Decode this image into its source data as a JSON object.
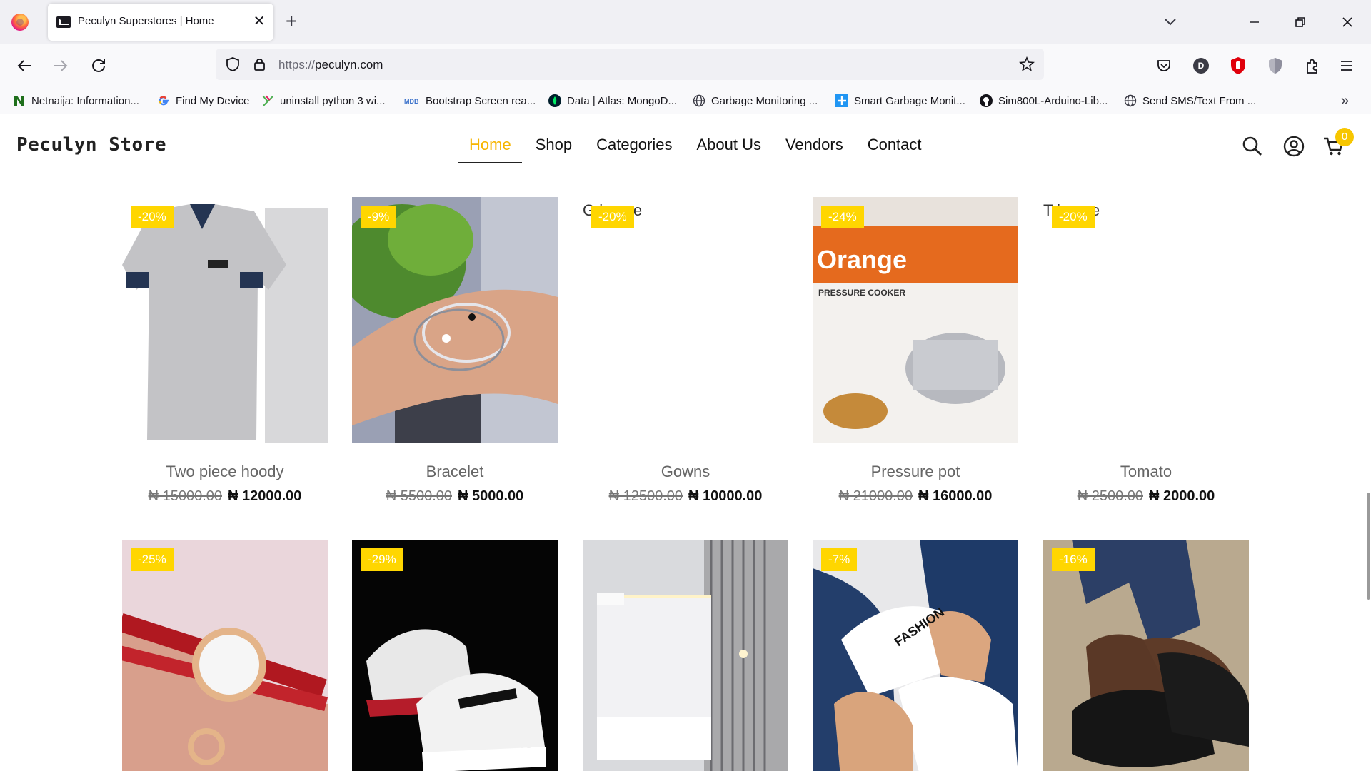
{
  "browser": {
    "tab_title": "Peculyn Superstores | Home",
    "url_scheme": "https://",
    "url_host": "peculyn.com",
    "profile_initial": "D",
    "bookmarks": [
      {
        "label": "Netnaija: Information...",
        "icon": "netnaija-icon"
      },
      {
        "label": "Find My Device",
        "icon": "google-icon"
      },
      {
        "label": "uninstall python 3 wi...",
        "icon": "bookmark-site-icon"
      },
      {
        "label": "Bootstrap Screen rea...",
        "icon": "mdb-icon"
      },
      {
        "label": "Data | Atlas: MongoD...",
        "icon": "mongodb-icon"
      },
      {
        "label": "Garbage Monitoring ...",
        "icon": "globe-icon"
      },
      {
        "label": "Smart Garbage Monit...",
        "icon": "bookmark-site-icon"
      },
      {
        "label": "Sim800L-Arduino-Lib...",
        "icon": "github-icon"
      },
      {
        "label": "Send SMS/Text From ...",
        "icon": "globe-icon"
      }
    ]
  },
  "site": {
    "brand": "Peculyn Store",
    "nav": [
      "Home",
      "Shop",
      "Categories",
      "About Us",
      "Vendors",
      "Contact"
    ],
    "active_nav": "Home",
    "cart_count": "0",
    "accent_color": "#f7b500",
    "badge_color": "#ffd600"
  },
  "products": [
    {
      "name": "Two piece hoody",
      "discount": "-20%",
      "old_price": "₦ 15000.00",
      "new_price": "₦ 12000.00",
      "alt": ""
    },
    {
      "name": "Bracelet",
      "discount": "-9%",
      "old_price": "₦ 5500.00",
      "new_price": "₦ 5000.00",
      "alt": ""
    },
    {
      "name": "Gowns",
      "discount": "-20%",
      "old_price": "₦ 12500.00",
      "new_price": "₦ 10000.00",
      "alt": "G      image"
    },
    {
      "name": "Pressure pot",
      "discount": "-24%",
      "old_price": "₦ 21000.00",
      "new_price": "₦ 16000.00",
      "alt": "",
      "label": "Orange",
      "sublabel": "PRESSURE COOKER"
    },
    {
      "name": "Tomato",
      "discount": "-20%",
      "old_price": "₦ 2500.00",
      "new_price": "₦ 2000.00",
      "alt": "T         image"
    },
    {
      "name": "",
      "discount": "-25%"
    },
    {
      "name": "",
      "discount": "-29%"
    },
    {
      "name": "",
      "discount": ""
    },
    {
      "name": "",
      "discount": "-7%",
      "label": "FASHION"
    },
    {
      "name": "",
      "discount": "-16%"
    }
  ]
}
